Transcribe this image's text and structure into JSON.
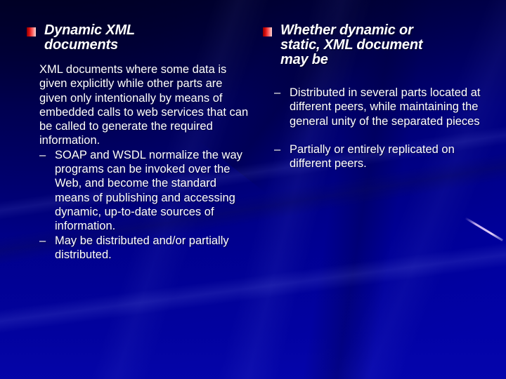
{
  "slide": {
    "background_color": "#00009c",
    "text_color": "#ffffff",
    "bullet_color": "#e01010",
    "dash": "–",
    "columns": [
      {
        "name": "left",
        "heading": "Dynamic XML documents",
        "paragraphs": [
          {
            "dashed": false,
            "text": "XML documents where some data is given explicitly while other parts are given only intentionally by means of embedded calls to web services that can be called to generate the required information."
          },
          {
            "dashed": true,
            "text": "SOAP and WSDL normalize the way programs can be invoked over the Web, and become the standard means of publishing and accessing dynamic, up-to-date sources of information."
          },
          {
            "dashed": true,
            "text": "May be distributed and/or partially distributed."
          }
        ]
      },
      {
        "name": "right",
        "heading": "Whether dynamic or static, XML document may be",
        "paragraphs": [
          {
            "dashed": true,
            "text": "Distributed in several parts located at different peers, while maintaining the general unity of the separated pieces"
          },
          {
            "dashed": true,
            "text": "Partially or entirely replicated on different peers."
          }
        ]
      }
    ]
  }
}
